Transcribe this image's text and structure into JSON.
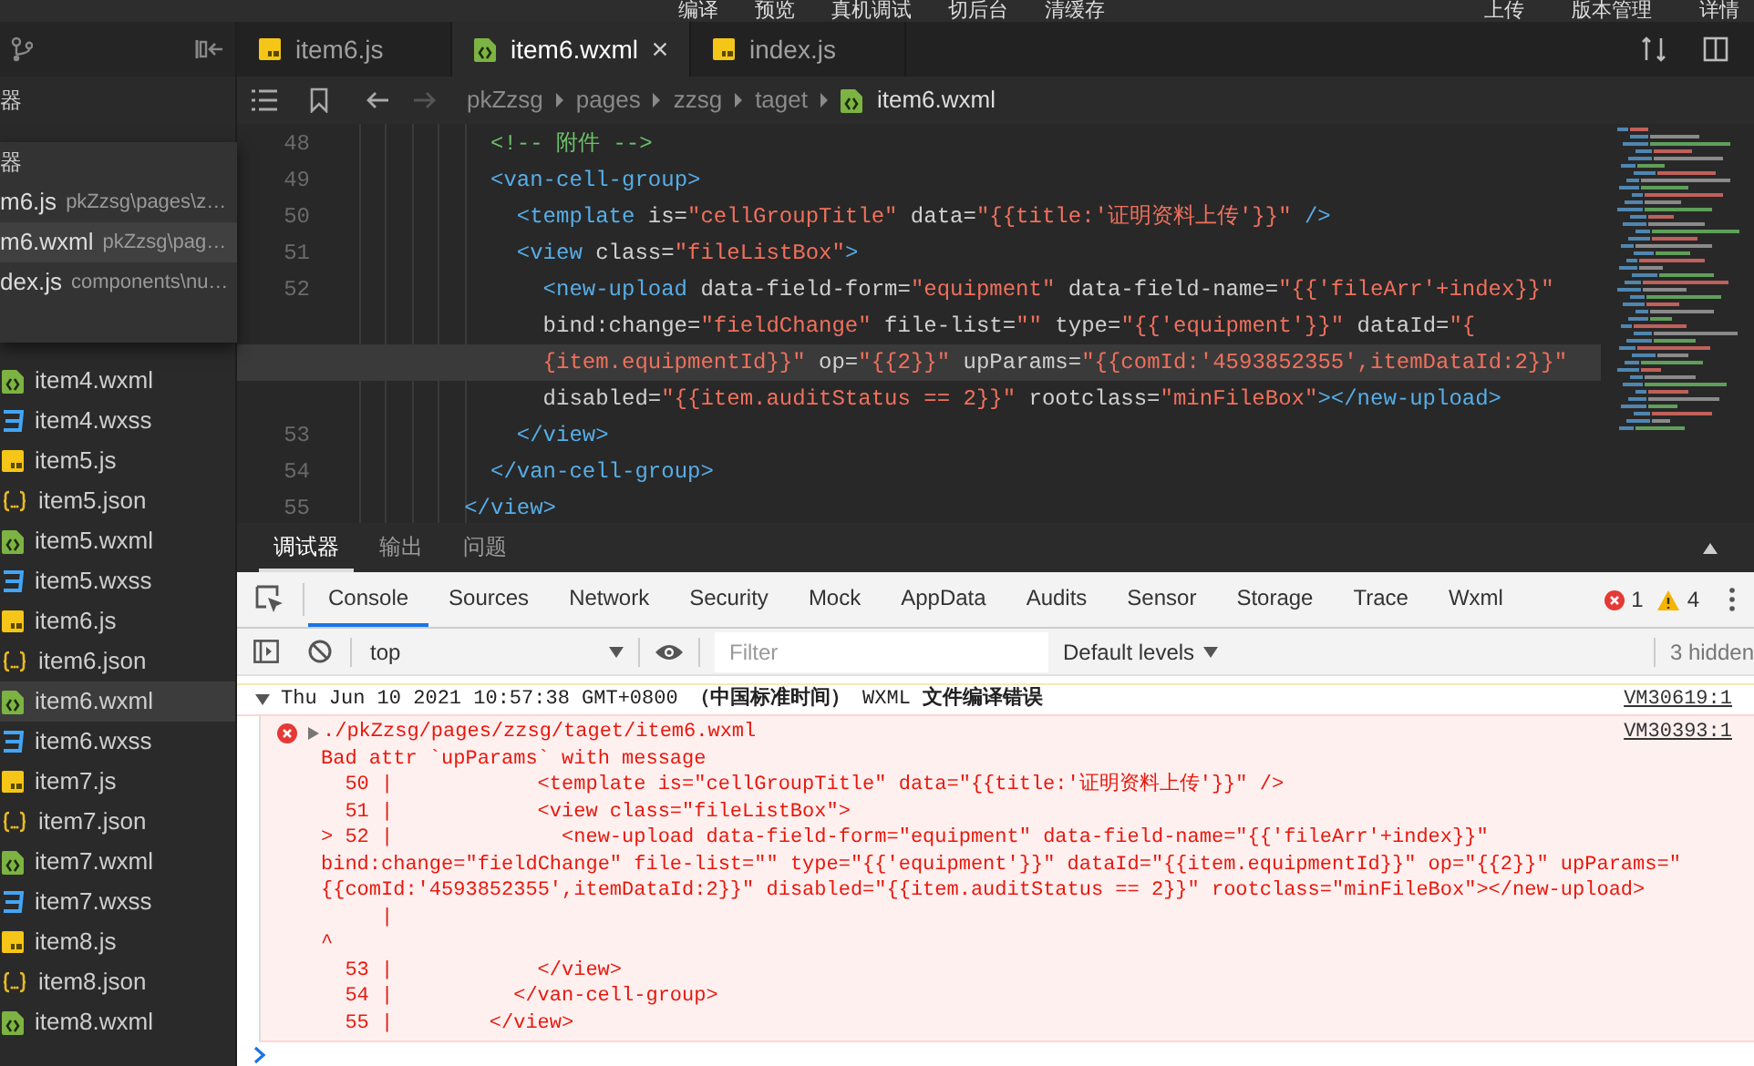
{
  "toolbar": {
    "left": [
      "编译",
      "预览",
      "真机调试",
      "切后台",
      "清缓存"
    ],
    "right": [
      "上传",
      "版本管理",
      "详情"
    ]
  },
  "sidebar": {
    "header": "器",
    "open_editors": {
      "header": "器",
      "items": [
        {
          "name": "m6.js",
          "path": "pkZzsg\\pages\\z…",
          "selected": false
        },
        {
          "name": "m6.wxml",
          "path": "pkZzsg\\pag…",
          "selected": true
        },
        {
          "name": "dex.js",
          "path": "components\\nu…",
          "selected": false
        }
      ]
    },
    "files": [
      {
        "name": "item4.wxml",
        "kind": "wxml",
        "selected": false
      },
      {
        "name": "item4.wxss",
        "kind": "wxss",
        "selected": false
      },
      {
        "name": "item5.js",
        "kind": "js",
        "selected": false
      },
      {
        "name": "item5.json",
        "kind": "json",
        "selected": false
      },
      {
        "name": "item5.wxml",
        "kind": "wxml",
        "selected": false
      },
      {
        "name": "item5.wxss",
        "kind": "wxss",
        "selected": false
      },
      {
        "name": "item6.js",
        "kind": "js",
        "selected": false
      },
      {
        "name": "item6.json",
        "kind": "json",
        "selected": false
      },
      {
        "name": "item6.wxml",
        "kind": "wxml",
        "selected": true
      },
      {
        "name": "item6.wxss",
        "kind": "wxss",
        "selected": false
      },
      {
        "name": "item7.js",
        "kind": "js",
        "selected": false
      },
      {
        "name": "item7.json",
        "kind": "json",
        "selected": false
      },
      {
        "name": "item7.wxml",
        "kind": "wxml",
        "selected": false
      },
      {
        "name": "item7.wxss",
        "kind": "wxss",
        "selected": false
      },
      {
        "name": "item8.js",
        "kind": "js",
        "selected": false
      },
      {
        "name": "item8.json",
        "kind": "json",
        "selected": false
      },
      {
        "name": "item8.wxml",
        "kind": "wxml",
        "selected": false
      }
    ]
  },
  "editor": {
    "tabs": [
      {
        "name": "item6.js",
        "kind": "js",
        "selected": false
      },
      {
        "name": "item6.wxml",
        "kind": "wxml",
        "selected": true
      },
      {
        "name": "index.js",
        "kind": "js",
        "selected": false
      }
    ],
    "breadcrumb": [
      "pkZzsg",
      "pages",
      "zzsg",
      "taget",
      "item6.wxml"
    ],
    "lines": [
      {
        "number": "48",
        "current": false,
        "segments": [
          {
            "kind": "comment",
            "text": "          <!-- 附件 -->"
          }
        ]
      },
      {
        "number": "49",
        "current": false,
        "segments": [
          {
            "kind": "tag",
            "text": "          <van-cell-group>"
          }
        ]
      },
      {
        "number": "50",
        "current": false,
        "segments": [
          {
            "kind": "tag",
            "text": "            <template"
          },
          {
            "kind": "attr",
            "text": " is="
          },
          {
            "kind": "string",
            "text": "\"cellGroupTitle\""
          },
          {
            "kind": "attr",
            "text": " data="
          },
          {
            "kind": "string",
            "text": "\"{{title:'证明资料上传'}}\""
          },
          {
            "kind": "tag",
            "text": " />"
          }
        ]
      },
      {
        "number": "51",
        "current": false,
        "segments": [
          {
            "kind": "tag",
            "text": "            <view"
          },
          {
            "kind": "attr",
            "text": " class="
          },
          {
            "kind": "string",
            "text": "\"fileListBox\""
          },
          {
            "kind": "tag",
            "text": ">"
          }
        ]
      },
      {
        "number": "52",
        "current": false,
        "segments": [
          {
            "kind": "tag",
            "text": "              <new-upload"
          },
          {
            "kind": "attr",
            "text": " data-field-form="
          },
          {
            "kind": "string",
            "text": "\"equipment\""
          },
          {
            "kind": "attr",
            "text": " data-field-name="
          },
          {
            "kind": "string",
            "text": "\"{{'fileArr'+index}}\""
          }
        ]
      },
      {
        "current": false,
        "segments": [
          {
            "kind": "attr",
            "text": "              bind:change="
          },
          {
            "kind": "string",
            "text": "\"fieldChange\""
          },
          {
            "kind": "attr",
            "text": " file-list="
          },
          {
            "kind": "string",
            "text": "\"\""
          },
          {
            "kind": "attr",
            "text": " type="
          },
          {
            "kind": "string",
            "text": "\"{{'equipment'}}\""
          },
          {
            "kind": "attr",
            "text": " dataId="
          },
          {
            "kind": "string",
            "text": "\"{"
          }
        ]
      },
      {
        "current": true,
        "segments": [
          {
            "kind": "string",
            "text": "              {item.equipmentId}}\""
          },
          {
            "kind": "attr",
            "text": " op="
          },
          {
            "kind": "string",
            "text": "\"{{2}}\""
          },
          {
            "kind": "attr",
            "text": " upParams="
          },
          {
            "kind": "string",
            "text": "\"{{comId:'4593852355',itemDataId:2}}\""
          }
        ]
      },
      {
        "current": false,
        "segments": [
          {
            "kind": "attr",
            "text": "              disabled="
          },
          {
            "kind": "string",
            "text": "\"{{item.auditStatus == 2}}\""
          },
          {
            "kind": "attr",
            "text": " rootclass="
          },
          {
            "kind": "string",
            "text": "\"minFileBox\""
          },
          {
            "kind": "tag",
            "text": "></new-upload>"
          }
        ]
      },
      {
        "number": "53",
        "current": false,
        "segments": [
          {
            "kind": "tag",
            "text": "            </view>"
          }
        ]
      },
      {
        "number": "54",
        "current": false,
        "segments": [
          {
            "kind": "tag",
            "text": "          </van-cell-group>"
          }
        ]
      },
      {
        "number": "55",
        "current": false,
        "segments": [
          {
            "kind": "tag",
            "text": "        </view>"
          }
        ]
      }
    ]
  },
  "devtools": {
    "panel_tabs": [
      {
        "label": "调试器",
        "selected": true
      },
      {
        "label": "输出",
        "selected": false
      },
      {
        "label": "问题",
        "selected": false
      }
    ],
    "tabs": [
      {
        "label": "Console",
        "selected": true
      },
      {
        "label": "Sources",
        "selected": false
      },
      {
        "label": "Network",
        "selected": false
      },
      {
        "label": "Security",
        "selected": false
      },
      {
        "label": "Mock",
        "selected": false
      },
      {
        "label": "AppData",
        "selected": false
      },
      {
        "label": "Audits",
        "selected": false
      },
      {
        "label": "Sensor",
        "selected": false
      },
      {
        "label": "Storage",
        "selected": false
      },
      {
        "label": "Trace",
        "selected": false
      },
      {
        "label": "Wxml",
        "selected": false
      }
    ],
    "error_count": "1",
    "warning_count": "4",
    "context": "top",
    "filter": {
      "placeholder": "Filter"
    },
    "levels": "Default levels",
    "hidden": "3 hidden",
    "console": {
      "group": {
        "expanded": true,
        "title": "Thu Jun 10 2021 10:57:38 GMT+0800 **（中国标准时间）** WXML **文件编译错误**",
        "source": "VM30619:1"
      },
      "error": {
        "file": "./pkZzsg/pages/zzsg/taget/item6.wxml",
        "source": "VM30393:1",
        "lines": [
          "Bad attr `upParams` with message",
          "  50 |            <template is=\"cellGroupTitle\" data=\"{{title:'证明资料上传'}}\" />",
          "  51 |            <view class=\"fileListBox\">",
          "> 52 |              <new-upload data-field-form=\"equipment\" data-field-name=\"{{'fileArr'+index}}\"",
          "bind:change=\"fieldChange\" file-list=\"\" type=\"{{'equipment'}}\" dataId=\"{{item.equipmentId}}\" op=\"{{2}}\" upParams=\"",
          "{{comId:'4593852355',itemDataId:2}}\" disabled=\"{{item.auditStatus == 2}}\" rootclass=\"minFileBox\"></new-upload>",
          "     |",
          "^",
          "  53 |            </view>",
          "  54 |          </van-cell-group>",
          "  55 |        </view>"
        ]
      }
    }
  }
}
